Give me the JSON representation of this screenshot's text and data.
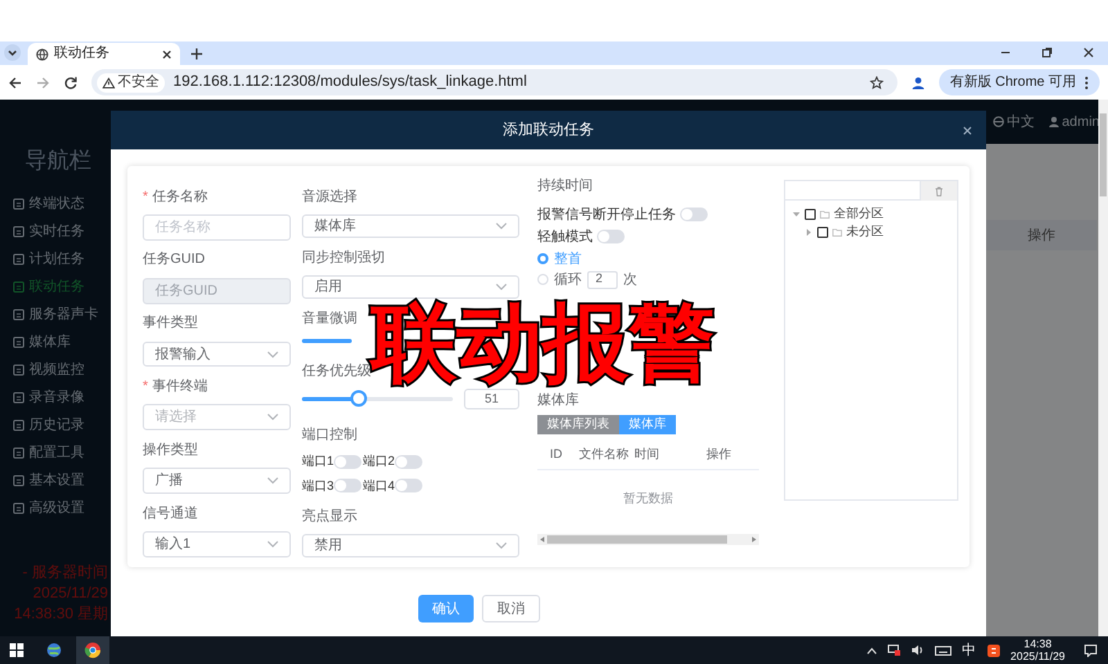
{
  "browser": {
    "tab_title": "联动任务",
    "insecure_label": "不安全",
    "url": "192.168.1.112:12308/modules/sys/task_linkage.html",
    "update_button": "有新版 Chrome 可用"
  },
  "sidebar": {
    "title": "导航栏",
    "items": [
      {
        "label": "终端状态",
        "selected": false
      },
      {
        "label": "实时任务",
        "selected": false
      },
      {
        "label": "计划任务",
        "selected": false
      },
      {
        "label": "联动任务",
        "selected": true
      },
      {
        "label": "服务器声卡",
        "selected": false
      },
      {
        "label": "媒体库",
        "selected": false
      },
      {
        "label": "视频监控",
        "selected": false
      },
      {
        "label": "录音录像",
        "selected": false
      },
      {
        "label": "历史记录",
        "selected": false
      },
      {
        "label": "配置工具",
        "selected": false
      },
      {
        "label": "基本设置",
        "selected": false
      },
      {
        "label": "高级设置",
        "selected": false
      }
    ],
    "server_time": [
      "- 服务器时间",
      "2025/11/29",
      "14:38:30 星期"
    ]
  },
  "header": {
    "language": "中文",
    "user": "admin"
  },
  "background_table": {
    "column_header": "操作"
  },
  "dialog": {
    "title": "添加联动任务",
    "required_mark": "*",
    "column_1": [
      {
        "kind": "text",
        "label": "任务名称",
        "required": true,
        "placeholder": "任务名称",
        "disabled": false
      },
      {
        "kind": "text",
        "label": "任务GUID",
        "required": false,
        "placeholder": "任务GUID",
        "disabled": true
      },
      {
        "kind": "select",
        "label": "事件类型",
        "required": false,
        "value": "报警输入"
      },
      {
        "kind": "select",
        "label": "事件终端",
        "required": true,
        "placeholder": "请选择"
      },
      {
        "kind": "select",
        "label": "操作类型",
        "required": false,
        "value": "广播"
      },
      {
        "kind": "select",
        "label": "信号通道",
        "required": false,
        "value": "输入1"
      }
    ],
    "column_2": [
      {
        "kind": "select",
        "label": "音源选择",
        "value": "媒体库"
      },
      {
        "kind": "select",
        "label": "同步控制强切",
        "value": "启用"
      },
      {
        "kind": "slider",
        "label": "音量微调"
      },
      {
        "kind": "slider",
        "label": "任务优先级",
        "level": 0.38,
        "value": "51"
      },
      {
        "kind": "switches",
        "label": "端口控制",
        "switches": [
          {
            "label": "端口1",
            "on": false
          },
          {
            "label": "端口2",
            "on": false
          },
          {
            "label": "端口3",
            "on": false
          },
          {
            "label": "端口4",
            "on": false
          }
        ]
      },
      {
        "kind": "select",
        "label": "亮点显示",
        "value": "禁用"
      }
    ],
    "column_3": {
      "heading": "持续时间",
      "switches": [
        {
          "label": "报警信号断开停止任务",
          "on": false
        },
        {
          "label": "轻触模式",
          "on": false
        }
      ],
      "radios": [
        {
          "selected": true,
          "parts": [
            {
              "kind": "text",
              "text": "整首"
            }
          ]
        },
        {
          "selected": false,
          "parts": [
            {
              "kind": "text",
              "text": "循环"
            },
            {
              "kind": "input",
              "text": "2"
            },
            {
              "kind": "text",
              "text": "次"
            }
          ]
        }
      ],
      "media_label": "媒体库",
      "media_tabs": [
        {
          "label": "媒体库列表",
          "selected": false
        },
        {
          "label": "媒体库",
          "selected": true
        }
      ],
      "table_columns": [
        "ID",
        "文件名称",
        "时间",
        "操作"
      ],
      "empty_text": "暂无数据"
    },
    "tree": [
      {
        "label": "全部分区",
        "checked": false,
        "expanded": true,
        "children": [
          {
            "label": "未分区",
            "checked": false,
            "expanded": false
          }
        ]
      }
    ],
    "buttons": [
      {
        "label": "确认",
        "primary": true
      },
      {
        "label": "取消",
        "primary": false
      }
    ]
  },
  "caption": "联动报警",
  "taskbar": {
    "ime": "中",
    "time": "14:38",
    "date": "2025/11/29"
  }
}
